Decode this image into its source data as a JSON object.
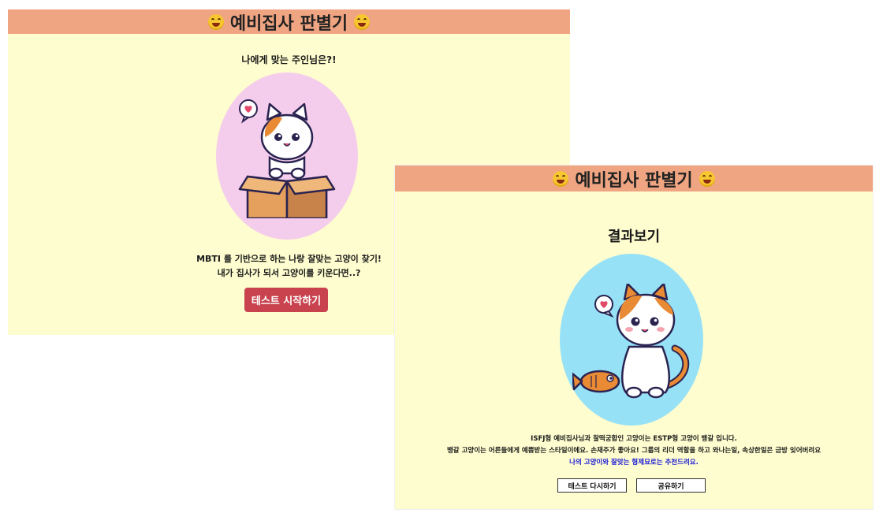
{
  "start_screen": {
    "header_title": "예비집사 판별기",
    "subtitle": "나에게 맞는 주인님은?!",
    "description_line1": "MBTI 를 기반으로 하는 나랑 잘맞는 고양이 찾기!",
    "description_line2": "내가 집사가 되서 고양이를 키운다면..?",
    "start_button_label": "테스트 시작하기",
    "oval_color": "#f4cdec"
  },
  "result_screen": {
    "header_title": "예비집사 판별기",
    "title": "결과보기",
    "result_line1": "ISFJ형 예비집사님과 찰떡궁합인 고양이는 ESTP형 고양이 뱅갈 입니다.",
    "result_line2": "뱅갈 고양이는 어른들에게 예쁨받는 스타일이에요. 손재주가 좋아요! 그룹의 리더 역할을 하고 와나는일, 속상한일은 금방 잊어버려요",
    "result_line3": "나의 고양이와 잘맞는 형제묘로는 추천드려요.",
    "retry_button_label": "테스트 다시하기",
    "share_button_label": "공유하기",
    "oval_color": "#97e1f7"
  },
  "colors": {
    "header_bg": "#f0a582",
    "page_bg": "#fefdcf",
    "start_button": "#c9434f",
    "highlight_text": "#1a1ad6"
  },
  "icons": {
    "header_emoji": "grinning-squinting-face-icon",
    "heart_bubble": "heart-speech-bubble-icon"
  }
}
